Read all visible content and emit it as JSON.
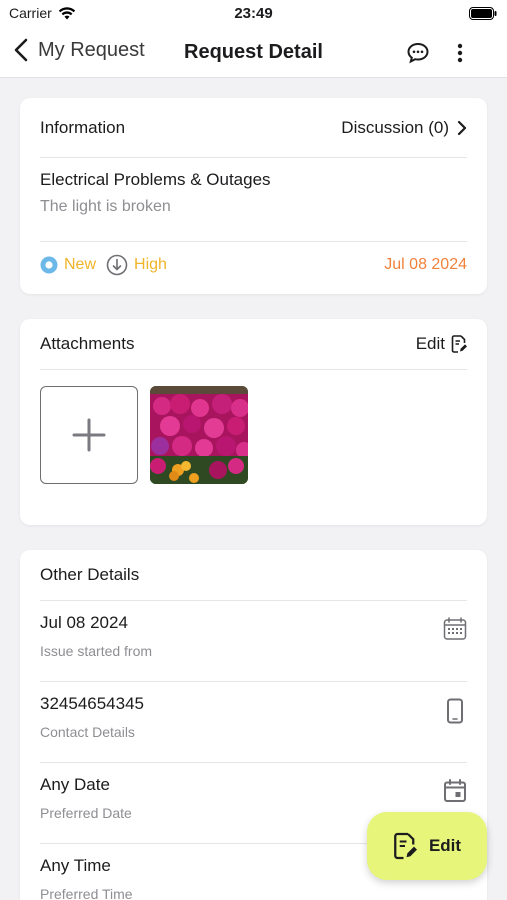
{
  "status_bar": {
    "carrier": "Carrier",
    "time": "23:49"
  },
  "nav": {
    "back_label": "My Request",
    "title": "Request Detail"
  },
  "info": {
    "heading": "Information",
    "discussion_label": "Discussion (0)",
    "request_title": "Electrical Problems & Outages",
    "request_description": "The light is broken",
    "status": "New",
    "priority": "High",
    "date": "Jul 08 2024"
  },
  "attachments": {
    "heading": "Attachments",
    "edit_label": "Edit"
  },
  "details": {
    "heading": "Other Details",
    "rows": [
      {
        "value": "Jul 08 2024",
        "label": "Issue started from",
        "icon": "calendar-grid-icon"
      },
      {
        "value": "32454654345",
        "label": "Contact Details",
        "icon": "phone-icon"
      },
      {
        "value": "Any Date",
        "label": "Preferred Date",
        "icon": "calendar-event-icon"
      },
      {
        "value": "Any Time",
        "label": "Preferred Time",
        "icon": "clock-icon"
      }
    ]
  },
  "fab": {
    "label": "Edit"
  },
  "colors": {
    "status_new": "#6cb8e8",
    "priority_high": "#f0b429",
    "date_accent": "#f0823c",
    "fab_bg": "#e7f57a"
  }
}
